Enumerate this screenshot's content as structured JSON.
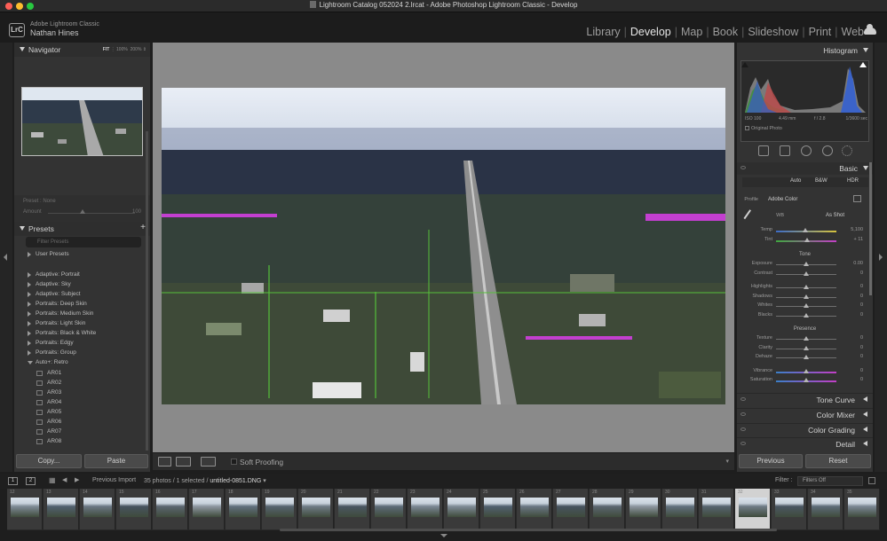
{
  "window": {
    "title": "Lightroom Catalog 052024 2.lrcat - Adobe Photoshop Lightroom Classic - Develop",
    "traffic_colors": [
      "#fe5f57",
      "#febc2e",
      "#28c840"
    ]
  },
  "identity": {
    "logo": "LrC",
    "app_name": "Adobe Lightroom Classic",
    "user_name": "Nathan Hines"
  },
  "modules": [
    "Library",
    "Develop",
    "Map",
    "Book",
    "Slideshow",
    "Print",
    "Web"
  ],
  "active_module": "Develop",
  "navigator": {
    "title": "Navigator",
    "zoom_fit": "FIT",
    "zoom_100": "100%",
    "zoom_200": "200%"
  },
  "preset_amount": {
    "preset_label": "Preset : None",
    "amount_label": "Amount",
    "amount_value": "100"
  },
  "presets": {
    "title": "Presets",
    "search_placeholder": "Filter Presets",
    "items": [
      "User Presets",
      "Adaptive: Portrait",
      "Adaptive: Sky",
      "Adaptive: Subject",
      "Portraits: Deep Skin",
      "Portraits: Medium Skin",
      "Portraits: Light Skin",
      "Portraits: Black & White",
      "Portraits: Edgy",
      "Portraits: Group",
      "Auto+: Retro"
    ],
    "sub_items": [
      "AR01",
      "AR02",
      "AR03",
      "AR04",
      "AR05",
      "AR06",
      "AR07",
      "AR08"
    ]
  },
  "left_buttons": {
    "copy": "Copy...",
    "paste": "Paste"
  },
  "toolbar": {
    "soft_proofing": "Soft Proofing"
  },
  "histogram": {
    "title": "Histogram",
    "iso": "ISO 100",
    "focal": "4.49 mm",
    "aperture": "f / 2.8",
    "shutter": "1/3600 sec",
    "original_photo": "Original Photo"
  },
  "basic": {
    "title": "Basic",
    "treatment": [
      "Auto",
      "B&W",
      "HDR"
    ],
    "profile_label": "Profile",
    "profile_value": "Adobe Color",
    "wb_label": "WB",
    "wb_value": "As Shot",
    "temp_label": "Temp",
    "temp_value": "5,100",
    "tint_label": "Tint",
    "tint_value": "+ 11",
    "tone_label": "Tone",
    "tone": [
      {
        "label": "Exposure",
        "value": "0.00"
      },
      {
        "label": "Contrast",
        "value": "0"
      },
      {
        "label": "Highlights",
        "value": "0"
      },
      {
        "label": "Shadows",
        "value": "0"
      },
      {
        "label": "Whites",
        "value": "0"
      },
      {
        "label": "Blacks",
        "value": "0"
      }
    ],
    "presence_label": "Presence",
    "presence": [
      {
        "label": "Texture",
        "value": "0"
      },
      {
        "label": "Clarity",
        "value": "0"
      },
      {
        "label": "Dehaze",
        "value": "0"
      },
      {
        "label": "Vibrance",
        "value": "0"
      },
      {
        "label": "Saturation",
        "value": "0"
      }
    ]
  },
  "collapsed_panels": [
    "Tone Curve",
    "Color Mixer",
    "Color Grading",
    "Detail"
  ],
  "right_buttons": {
    "previous": "Previous",
    "reset": "Reset"
  },
  "filmbar": {
    "page1": "1",
    "page2": "2",
    "source": "Previous Import",
    "count_prefix": "35 photos / 1 selected / ",
    "filename": "untitled-0851.DNG",
    "filter_label": "Filter :",
    "filter_value": "Filters Off"
  },
  "filmstrip": {
    "numbers": [
      "12",
      "13",
      "14",
      "15",
      "16",
      "17",
      "18",
      "19",
      "20",
      "21",
      "22",
      "23",
      "24",
      "25",
      "26",
      "27",
      "28",
      "29",
      "30",
      "31",
      "32",
      "33",
      "34",
      "35"
    ],
    "selected": "32"
  }
}
